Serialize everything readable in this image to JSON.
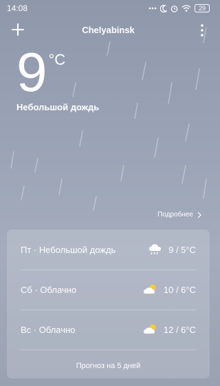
{
  "status_bar": {
    "time": "14:08",
    "icons": [
      "dots-icon",
      "moon-icon",
      "alarm-icon",
      "wifi-icon",
      "battery-icon"
    ],
    "battery": "29"
  },
  "header": {
    "city": "Chelyabinsk",
    "add_icon": "plus-icon",
    "menu_icon": "vertical-dots-icon"
  },
  "current": {
    "temp": "9",
    "unit": "°C",
    "condition": "Небольшой дождь"
  },
  "more_label": "Подробнее",
  "forecast": [
    {
      "label": "Пт · Небольшой дождь",
      "icon": "cloud-rain-icon",
      "temps": "9 / 5°C"
    },
    {
      "label": "Сб · Облачно",
      "icon": "cloud-sun-icon",
      "temps": "10 / 6°C"
    },
    {
      "label": "Вс · Облачно",
      "icon": "cloud-sun-icon",
      "temps": "12 / 6°C"
    }
  ],
  "forecast_button": "Прогноз на 5 дней",
  "colors": {
    "background_top": "#8f98ab",
    "background_bottom": "#9aa2b2",
    "sun": "#f5c842",
    "text": "#ffffff"
  }
}
